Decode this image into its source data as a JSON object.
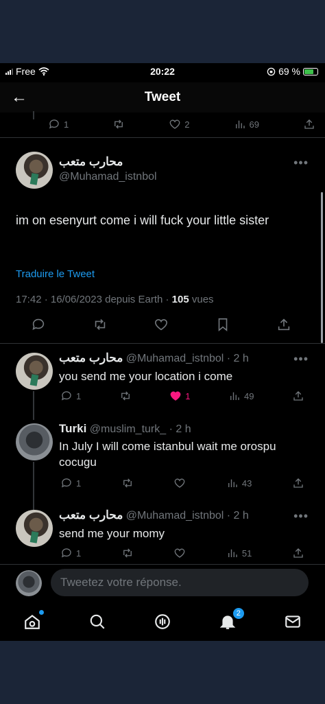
{
  "status_bar": {
    "carrier": "Free",
    "time": "20:22",
    "battery": "69 %"
  },
  "header": {
    "title": "Tweet"
  },
  "prev_tweet": {
    "replies": "1",
    "likes": "2",
    "views": "69"
  },
  "main_tweet": {
    "name": "محارب متعب",
    "handle": "@Muhamad_istnbol",
    "text": "im on esenyurt come i will fuck your little sister",
    "translate": "Traduire le Tweet",
    "meta_prefix": "17:42 · 16/06/2023 depuis Earth · ",
    "views_count": "105",
    "views_label": " vues"
  },
  "replies": [
    {
      "name": "محارب متعب",
      "handle": "@Muhamad_istnbol · 2 h",
      "text": "you send me your location i come",
      "replies": "1",
      "likes": "1",
      "views": "49"
    },
    {
      "name": "Turki",
      "handle": "@muslim_turk_ · 2 h",
      "text": "In July I will come istanbul wait me orospu cocugu",
      "replies": "1",
      "likes": "",
      "views": "43"
    },
    {
      "name": "محارب متعب",
      "handle": "@Muhamad_istnbol · 2 h",
      "text": "send me your momy",
      "replies": "1",
      "likes": "",
      "views": "51"
    }
  ],
  "composer": {
    "placeholder": "Tweetez votre réponse."
  },
  "tabbar": {
    "notifications_badge": "2"
  },
  "colors": {
    "accent": "#1d9bf0",
    "like": "#f91880",
    "background": "#000000"
  }
}
